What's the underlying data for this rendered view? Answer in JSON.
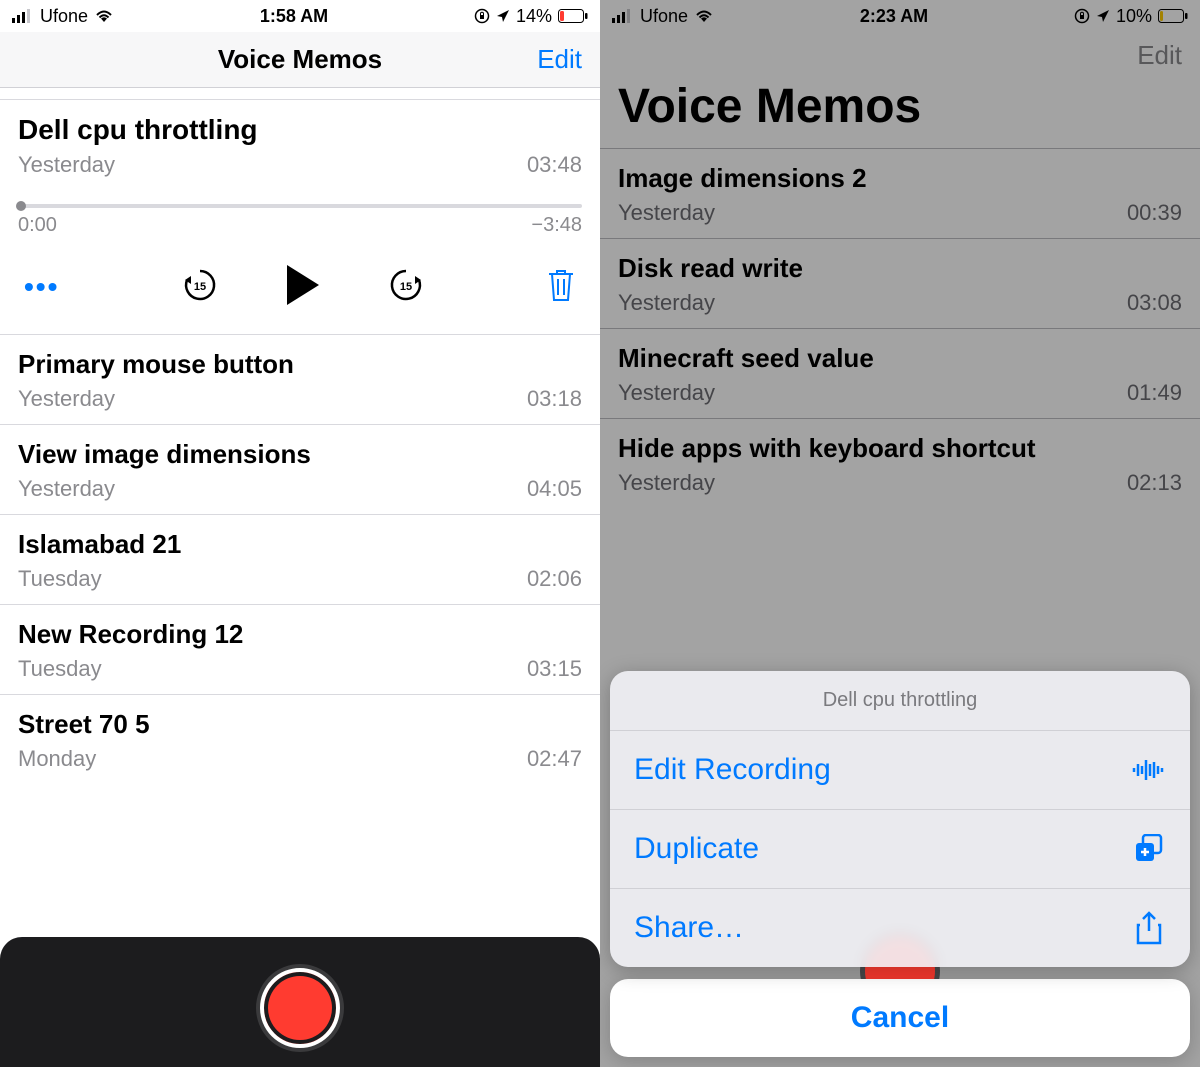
{
  "left": {
    "status": {
      "carrier": "Ufone",
      "time": "1:58 AM",
      "battery_pct": "14%"
    },
    "nav": {
      "title": "Voice Memos",
      "edit": "Edit"
    },
    "expanded": {
      "title": "Dell cpu throttling",
      "date": "Yesterday",
      "duration": "03:48",
      "elapsed": "0:00",
      "remaining": "−3:48"
    },
    "memos": [
      {
        "title": "Primary mouse button",
        "date": "Yesterday",
        "duration": "03:18"
      },
      {
        "title": "View image dimensions",
        "date": "Yesterday",
        "duration": "04:05"
      },
      {
        "title": "Islamabad 21",
        "date": "Tuesday",
        "duration": "02:06"
      },
      {
        "title": "New Recording 12",
        "date": "Tuesday",
        "duration": "03:15"
      },
      {
        "title": "Street 70 5",
        "date": "Monday",
        "duration": "02:47"
      }
    ]
  },
  "right": {
    "status": {
      "carrier": "Ufone",
      "time": "2:23 AM",
      "battery_pct": "10%"
    },
    "nav": {
      "edit": "Edit",
      "large_title": "Voice Memos"
    },
    "memos": [
      {
        "title": "Image dimensions 2",
        "date": "Yesterday",
        "duration": "00:39"
      },
      {
        "title": "Disk read write",
        "date": "Yesterday",
        "duration": "03:08"
      },
      {
        "title": "Minecraft seed value",
        "date": "Yesterday",
        "duration": "01:49"
      },
      {
        "title": "Hide apps with keyboard shortcut",
        "date": "Yesterday",
        "duration": "02:13"
      }
    ],
    "sheet": {
      "header": "Dell cpu throttling",
      "edit_recording": "Edit Recording",
      "duplicate": "Duplicate",
      "share": "Share…",
      "cancel": "Cancel"
    }
  }
}
